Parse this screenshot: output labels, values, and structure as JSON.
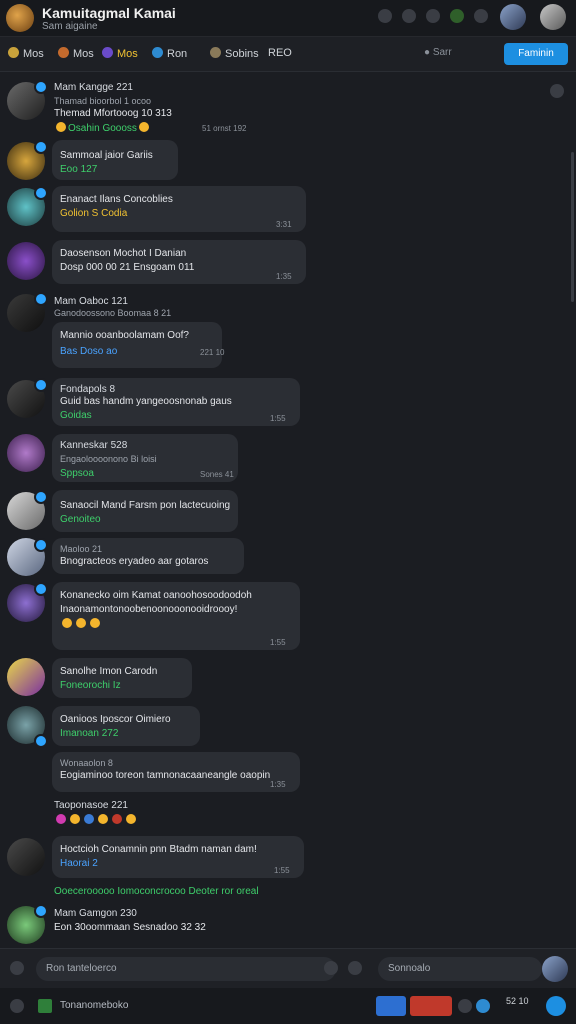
{
  "header": {
    "title": "Kamuitagmal Kamai",
    "subtitle": "Sam aigaine"
  },
  "tabs": [
    {
      "label": "Mos"
    },
    {
      "label": "Mos"
    },
    {
      "label": "Mos"
    },
    {
      "label": "Ron"
    },
    {
      "label": "Sobins"
    },
    {
      "label": "REO"
    }
  ],
  "toolbar": {
    "search_label": "Sarr",
    "primary_label": "Faminin"
  },
  "messages": [
    {
      "name": "Mam Kangge 221",
      "meta": "Thamad bioorbol 1 ocoo",
      "line1": "Themad Mfortooog 10 313",
      "line2": "Osahin Goooss",
      "time": "51 ornst 192"
    },
    {
      "name": "",
      "meta": "",
      "line1": "Sammoal jaior Gariis",
      "line2": "Eoo 127",
      "time": ""
    },
    {
      "name": "",
      "meta": "",
      "line1": "Enanact Ilans Concoblies",
      "line2": "Golion S Codia",
      "time": "3:31"
    },
    {
      "name": "",
      "meta": "",
      "line1": "Daosenson Mochot I Danian",
      "line2": "Dosp 000 00 21 Ensgoam 011",
      "time": "1:35"
    },
    {
      "name": "Mam Oaboc 121",
      "meta": "Ganodoossono Boomaa 8 21",
      "line1": "Mannio ooanboolamam Oof?",
      "line2": "Bas Doso ao",
      "time": "221 10"
    },
    {
      "name": "Fondapols 8",
      "meta": "",
      "line1": "Guid bas handm yangeoosnonab gaus",
      "line2": "Goidas",
      "time": "1:55"
    },
    {
      "name": "Kanneskar 528",
      "meta": "Engaoloooonono Bi loisi",
      "line1": "Sppsoa",
      "line2": "",
      "time": "Sones 41"
    },
    {
      "name": "",
      "meta": "",
      "line1": "Sanaocil Mand Farsm pon lactecuoing",
      "line2": "Genoiteo",
      "time": ""
    },
    {
      "name": "Maoloo 21",
      "meta": "",
      "line1": "Bnogracteos eryadeo aar gotaros",
      "line2": "",
      "time": ""
    },
    {
      "name": "",
      "meta": "",
      "line1": "Konanecko oim Kamat oanoohosoodoodoh",
      "line2": "Inaonamontonoobenoonooonooidroooy!",
      "time": "1:55"
    },
    {
      "name": "",
      "meta": "",
      "line1": "Sanolhe Imon Carodn",
      "line2": "Foneorochi Iz",
      "time": ""
    },
    {
      "name": "",
      "meta": "",
      "line1": "Oanioos Iposcor Oimiero",
      "line2": "Imanoan 272",
      "time": ""
    },
    {
      "name": "Wonaaolon 8",
      "meta": "",
      "line1": "Eogiaminoo toreon tamnonacaaneangle oaopin",
      "line2": "",
      "time": "1:35"
    },
    {
      "name": "Taoponasoe 221",
      "meta": "",
      "line1": "",
      "line2": "",
      "time": ""
    },
    {
      "name": "",
      "meta": "",
      "line1": "Hoctcioh Conamnin pnn Btadm naman dam!",
      "line2": "Haorai 2",
      "time": "1:55"
    },
    {
      "name": "",
      "meta": "",
      "line1": "Ooecerooooo Iomoconcrocoo Deoter ror oreal",
      "line2": "",
      "time": ""
    },
    {
      "name": "Mam Gamgon 230",
      "meta": "",
      "line1": "Eon 30oommaan Sesnadoo 32 32",
      "line2": "",
      "time": ""
    }
  ],
  "composer": {
    "placeholder": "Ron tanteloerco",
    "search_placeholder": "Sonnoalo"
  },
  "bottom": {
    "status": "Tonanomeboko",
    "count": "52 10"
  }
}
